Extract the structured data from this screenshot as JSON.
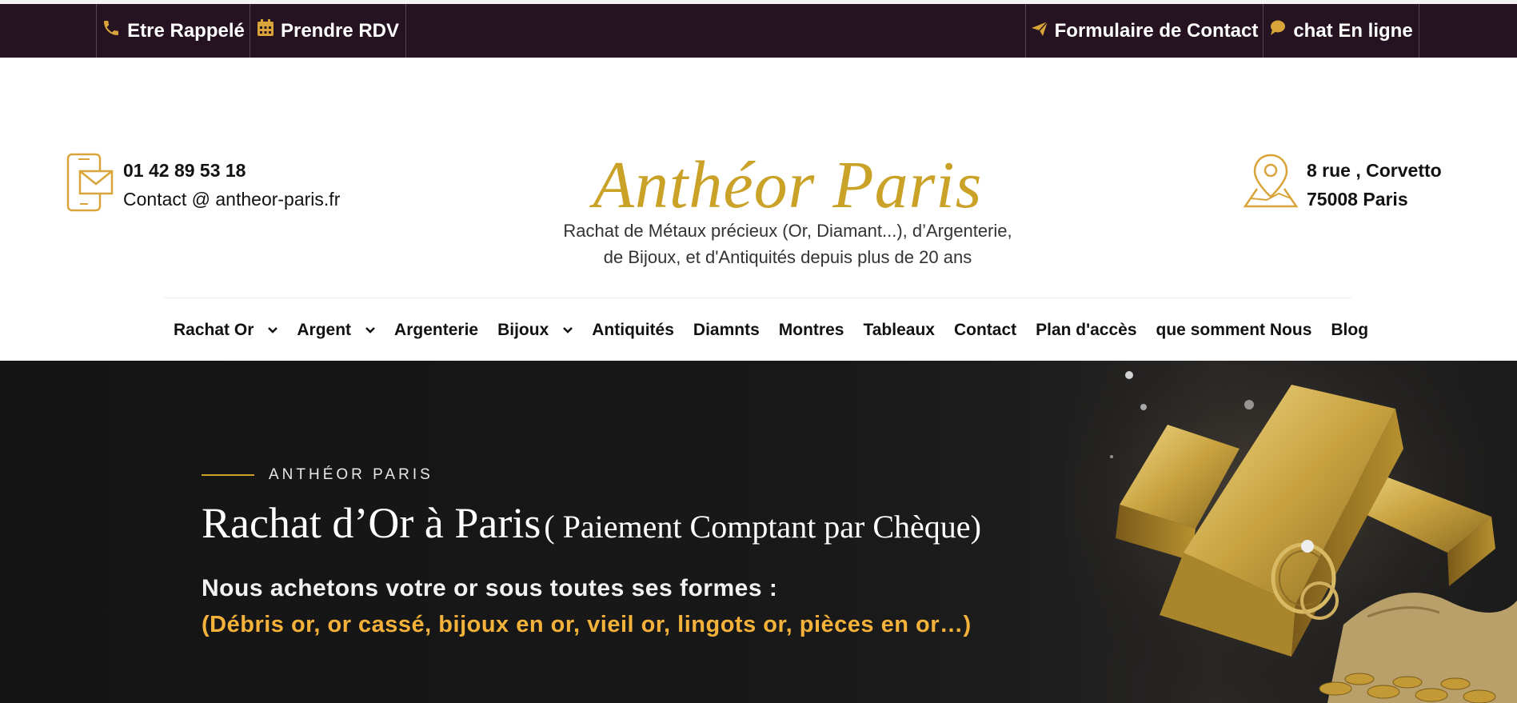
{
  "topbar": {
    "left": [
      {
        "icon": "phone-icon",
        "label": "Etre Rappelé"
      },
      {
        "icon": "calendar-icon",
        "label": "Prendre RDV"
      }
    ],
    "right": [
      {
        "icon": "paper-plane-icon",
        "label": "Formulaire de Contact"
      },
      {
        "icon": "chat-bubble-icon",
        "label": "chat En ligne"
      }
    ]
  },
  "contact": {
    "icon": "mobile-mail-icon",
    "phone": "01 42 89 53 18",
    "email": "Contact @ antheor-paris.fr"
  },
  "logo": {
    "name": "Anthéor Paris",
    "tagline_line1": "Rachat de Métaux précieux (Or, Diamant...), d’Argenterie,",
    "tagline_line2": "de Bijoux, et d'Antiquités depuis plus de 20 ans"
  },
  "address": {
    "icon": "map-pin-icon",
    "line1": "8 rue , Corvetto",
    "line2": "75008 Paris"
  },
  "nav": {
    "items": [
      {
        "label": "Rachat Or",
        "dropdown": true
      },
      {
        "label": "Argent",
        "dropdown": true
      },
      {
        "label": "Argenterie",
        "dropdown": false
      },
      {
        "label": "Bijoux",
        "dropdown": true
      },
      {
        "label": "Antiquités",
        "dropdown": false
      },
      {
        "label": "Diamnts",
        "dropdown": false
      },
      {
        "label": "Montres",
        "dropdown": false
      },
      {
        "label": "Tableaux",
        "dropdown": false
      },
      {
        "label": "Contact",
        "dropdown": false
      },
      {
        "label": "Plan d'accès",
        "dropdown": false
      },
      {
        "label": "que somment Nous",
        "dropdown": false
      },
      {
        "label": "Blog",
        "dropdown": false
      }
    ]
  },
  "hero": {
    "eyebrow": "ANTHÉOR PARIS",
    "title_main": "Rachat d’Or à Paris",
    "title_paren": "( Paiement Comptant par Chèque)",
    "subtitle": "Nous achetons votre or sous toutes ses formes :",
    "forms": "(Débris or, or cassé, bijoux en or, vieil or, lingots or, pièces en or…)",
    "image": "gold-bars-ring-coins-image"
  },
  "colors": {
    "topbar_bg": "#261322",
    "gold": "#c9a227",
    "hero_accent": "#f4b23a",
    "hero_bg": "#141414"
  }
}
